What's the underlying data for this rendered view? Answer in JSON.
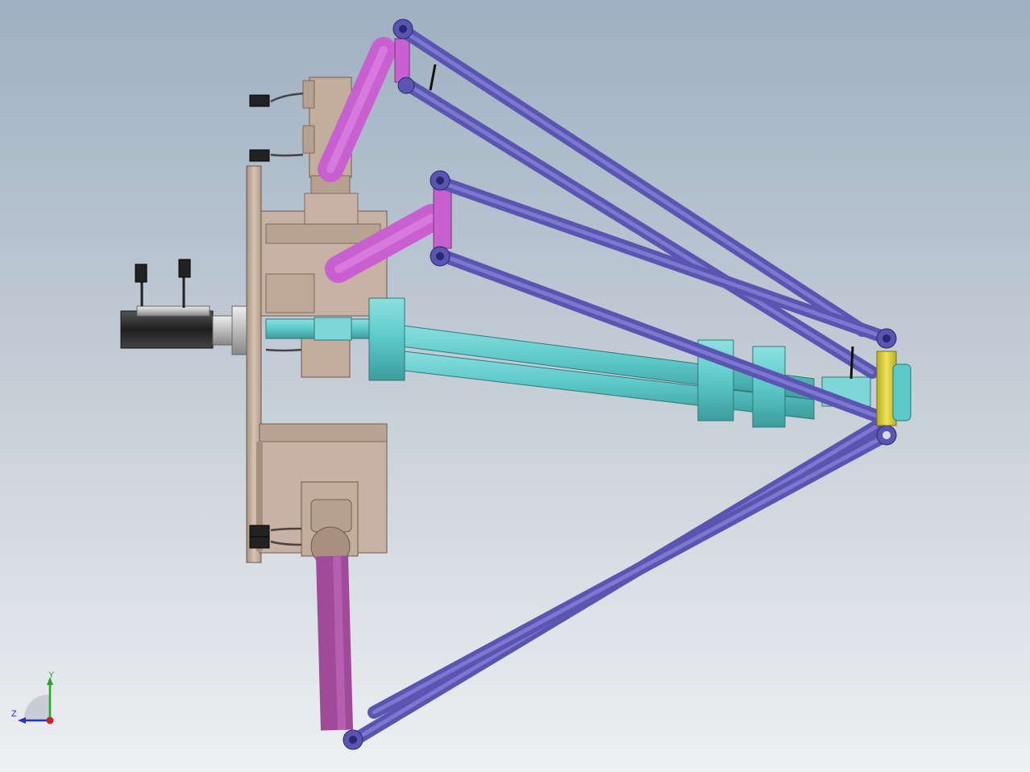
{
  "colors": {
    "background_top": "#9fb0c2",
    "background_bottom": "#eef0f2",
    "frame": "#c9b2a3",
    "frame_dark": "#a89080",
    "upper_arm": "#c860d0",
    "lower_arm": "#a04a9a",
    "parallel_link": "#5a55b0",
    "parallel_link_light": "#7a76d0",
    "telescopic_shaft": "#5cc8c8",
    "telescopic_shaft_dark": "#3d9c9c",
    "motor_body": "#2b2b2b",
    "motor_silver": "#c9c9c9",
    "end_effector": "#d6cc3a",
    "axis_y": "#22aa22",
    "axis_z": "#2233cc",
    "axis_origin": "#cc2222"
  },
  "view": {
    "icons": [
      "view-triad-icon"
    ],
    "triad": {
      "y_label": "Y",
      "z_label": "Z"
    }
  }
}
